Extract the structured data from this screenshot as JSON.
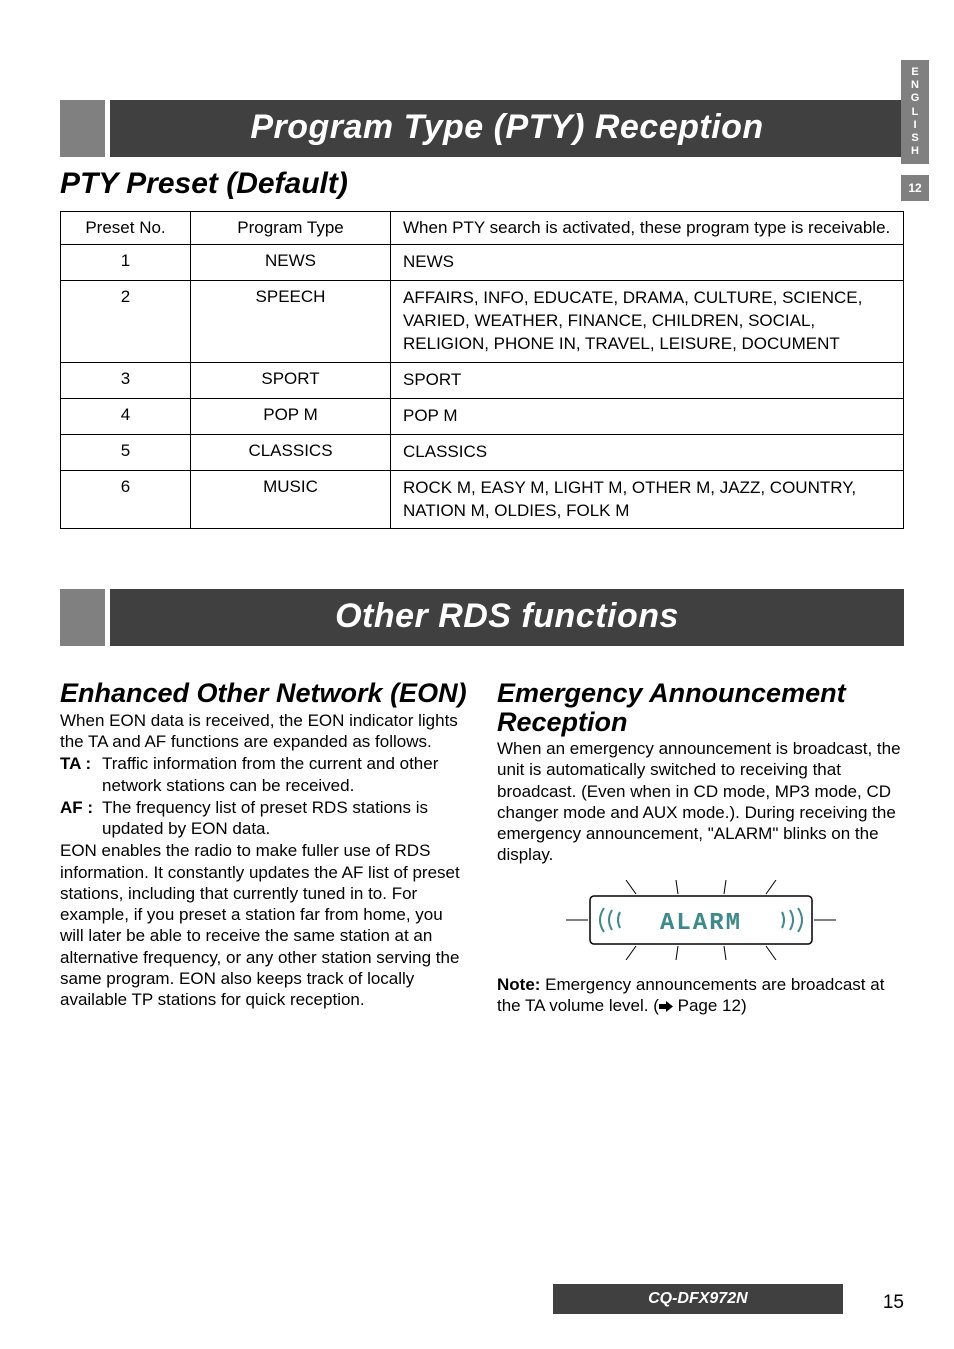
{
  "sidebar": {
    "lang_letters": [
      "E",
      "N",
      "G",
      "L",
      "I",
      "S",
      "H"
    ],
    "number": "12"
  },
  "section1": {
    "title": "Program Type (PTY) Reception",
    "subtitle": "PTY Preset (Default)",
    "table": {
      "headers": {
        "preset_no": "Preset No.",
        "program_type": "Program Type",
        "desc": "When PTY search is activated, these program type is receivable."
      },
      "rows": [
        {
          "no": "1",
          "type": "NEWS",
          "desc": "NEWS"
        },
        {
          "no": "2",
          "type": "SPEECH",
          "desc": "AFFAIRS, INFO, EDUCATE, DRAMA, CULTURE, SCIENCE, VARIED, WEATHER, FINANCE, CHILDREN, SOCIAL, RELIGION, PHONE IN, TRAVEL, LEISURE, DOCUMENT"
        },
        {
          "no": "3",
          "type": "SPORT",
          "desc": "SPORT"
        },
        {
          "no": "4",
          "type": "POP M",
          "desc": "POP M"
        },
        {
          "no": "5",
          "type": "CLASSICS",
          "desc": "CLASSICS"
        },
        {
          "no": "6",
          "type": "MUSIC",
          "desc": "ROCK M, EASY M, LIGHT M, OTHER M, JAZZ, COUNTRY, NATION M, OLDIES, FOLK M"
        }
      ]
    }
  },
  "section2": {
    "title": "Other RDS functions",
    "eon": {
      "heading": "Enhanced Other Network (EON)",
      "intro": "When EON data is received, the EON indicator lights the TA and AF functions are expanded as follows.",
      "bullets": [
        {
          "tag": "TA :",
          "text": "Traffic information from the current and other network stations can be received."
        },
        {
          "tag": "AF :",
          "text": "The frequency list of preset RDS stations is updated by EON data."
        }
      ],
      "para": "EON enables the radio to make fuller use of RDS information.  It constantly updates the AF list of preset stations, including that currently tuned in to.  For example, if you preset a station far from home, you will later be able to receive the same station at an alternative frequency, or any other station serving the same program. EON also keeps track of locally available TP stations for quick reception."
    },
    "emergency": {
      "heading": "Emergency Announcement Reception",
      "para": "When an emergency announcement is broadcast, the unit is automatically switched to receiving that broadcast. (Even when in CD mode, MP3 mode, CD changer mode and AUX mode.). During receiving the emergency announcement, \"ALARM\" blinks on the display.",
      "alarm_label": "ALARM",
      "note_label": "Note:",
      "note_text": " Emergency announcements are broadcast at the TA volume level. (",
      "note_page": " Page 12)"
    }
  },
  "footer": {
    "model": "CQ-DFX972N",
    "page": "15"
  }
}
